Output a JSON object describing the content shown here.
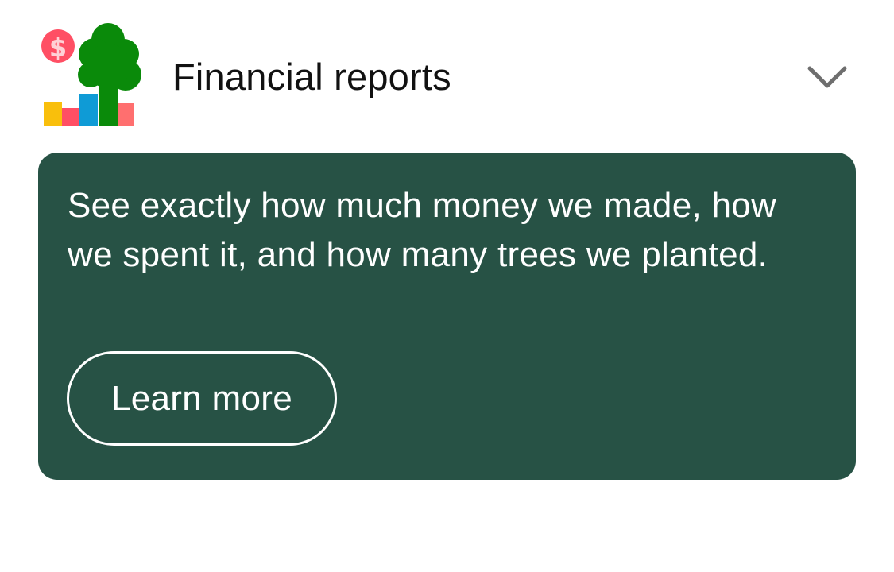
{
  "header": {
    "logo_icon": "tree-money-chart-icon",
    "title": "Financial reports",
    "expand_icon": "chevron-down-icon"
  },
  "card": {
    "description": "See exactly how much money we made, how we spent it, and how many trees we planted.",
    "button_label": "Learn more"
  },
  "colors": {
    "card_background": "#275245",
    "tree_green": "#0a8a0a",
    "coin_red": "#ff4f64",
    "bar_yellow": "#f9bf0c",
    "bar_blue": "#0f9bd6",
    "bar_salmon": "#ff6f6f",
    "chevron_gray": "#6e6e6e"
  }
}
